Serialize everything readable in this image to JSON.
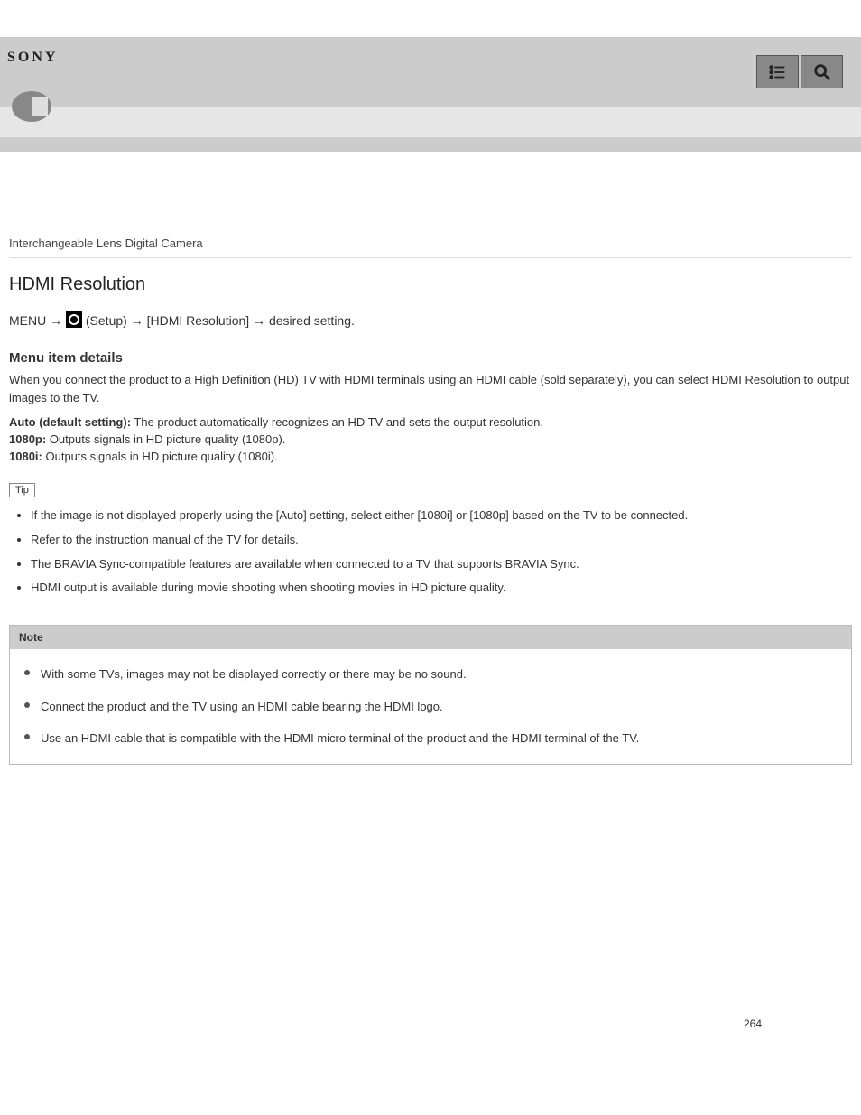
{
  "header": {
    "brand": "SONY"
  },
  "section_label": "Interchangeable Lens Digital Camera",
  "page_title": "HDMI Resolution",
  "menu_line_1": "MENU → ",
  "menu_line_2": " (Setup) → [HDMI Resolution] → desired setting.",
  "details_heading": "Menu item details",
  "details_intro": "When you connect the product to a High Definition (HD) TV with HDMI terminals using an HDMI cable (sold separately), you can select HDMI Resolution to output images to the TV.",
  "options": {
    "auto": {
      "label": "Auto (default setting):",
      "desc": " The product automatically recognizes an HD TV and sets the output resolution."
    },
    "1080p": {
      "label": "1080p:",
      "desc": " Outputs signals in HD picture quality (1080p)."
    },
    "1080i": {
      "label": "1080i:",
      "desc": " Outputs signals in HD picture quality (1080i)."
    }
  },
  "tip_label": "Tip",
  "tips": [
    "If the image is not displayed properly using the [Auto] setting, select either [1080i] or [1080p] based on the TV to be connected.",
    "Refer to the instruction manual of the TV for details.",
    "The BRAVIA Sync-compatible features are available when connected to a TV that supports BRAVIA Sync.",
    "HDMI output is available during movie shooting when shooting movies in HD picture quality."
  ],
  "note_head": "Note",
  "notes": [
    "With some TVs, images may not be displayed correctly or there may be no sound.",
    "Connect the product and the TV using an HDMI cable bearing the HDMI logo.",
    "Use an HDMI cable that is compatible with the HDMI micro terminal of the product and the HDMI terminal of the TV."
  ],
  "page_number": "264"
}
